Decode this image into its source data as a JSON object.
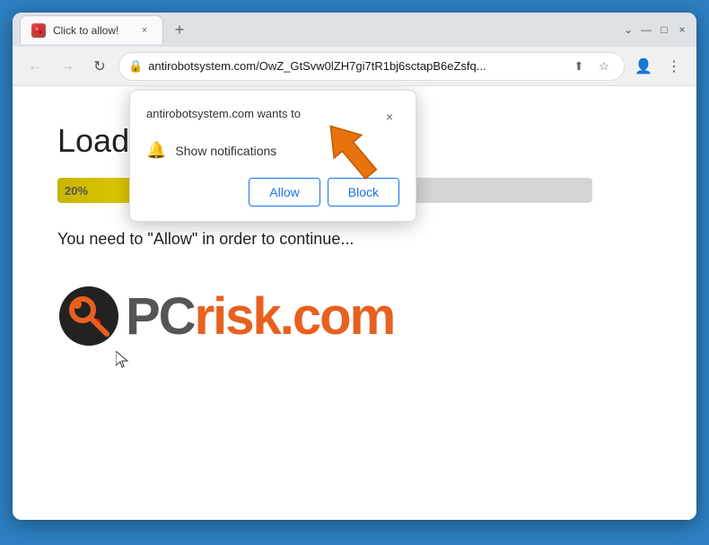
{
  "browser": {
    "tab": {
      "favicon_label": "★",
      "title": "Click to allow!",
      "close_symbol": "×"
    },
    "new_tab_symbol": "+",
    "window_controls": {
      "chevron_down": "⌄",
      "minimize": "—",
      "maximize": "□",
      "close": "×"
    },
    "toolbar": {
      "back_symbol": "←",
      "forward_symbol": "→",
      "reload_symbol": "↻",
      "lock_symbol": "🔒",
      "address": "antirobotsystem.com/OwZ_GtSvw0lZH7gi7tR1bj6sctapB6eZsfq...",
      "share_symbol": "⬆",
      "star_symbol": "☆",
      "account_symbol": "👤",
      "menu_symbol": "⋮"
    }
  },
  "notification_popup": {
    "title": "antirobotsystem.com wants to",
    "close_symbol": "×",
    "bell_symbol": "🔔",
    "notification_label": "Show notifications",
    "allow_label": "Allow",
    "block_label": "Block"
  },
  "page": {
    "loading_text": "Loading...",
    "progress_percent": "20%",
    "instruction_text": "You need to \"Allow\" in order to continue...",
    "logo": {
      "pc_text": "PC",
      "risk_text": "risk.com"
    }
  },
  "colors": {
    "accent": "#1a73e8",
    "orange_arrow": "#e8720c",
    "progress_yellow": "#c8b400"
  }
}
